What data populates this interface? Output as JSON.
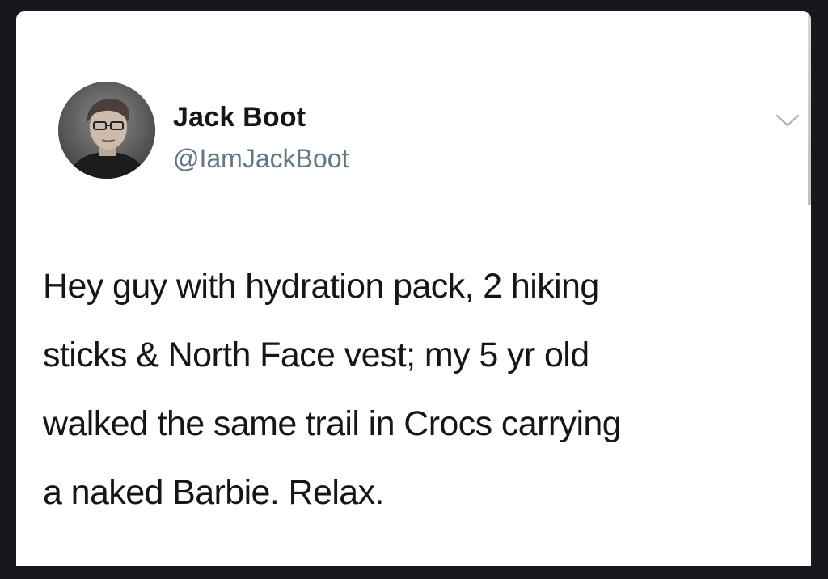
{
  "tweet": {
    "author": {
      "display_name": "Jack Boot",
      "handle": "@IamJackBoot",
      "avatar_icon": "profile-photo"
    },
    "menu_icon": "chevron-down-icon",
    "text_lines": [
      "Hey guy with hydration pack, 2 hiking",
      "sticks & North Face vest; my 5 yr old",
      "walked the same trail in Crocs carrying",
      "a naked Barbie. Relax."
    ]
  },
  "colors": {
    "background": "#16181d",
    "card": "#ffffff",
    "text": "#14171a",
    "handle": "#657786",
    "chevron": "#aab8c2"
  }
}
